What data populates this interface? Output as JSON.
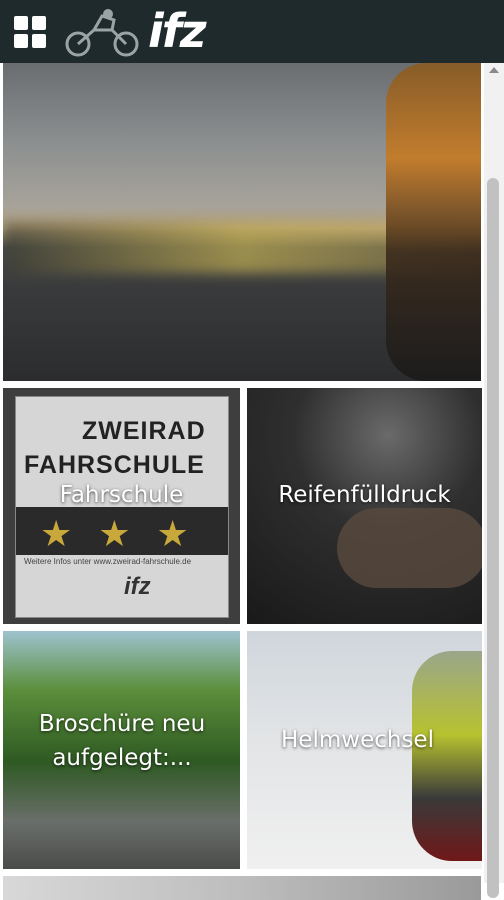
{
  "header": {
    "menu_icon": "grid-icon",
    "logo_text": "ifz",
    "logo_icon": "motorcycle-icon"
  },
  "tiles": [
    {
      "label": "Fahrschule",
      "card": {
        "line1": "ZWEIRAD",
        "line2": "FAHRSCHULE",
        "stars": "★★★",
        "url": "Weitere Infos unter www.zweirad-fahrschule.de",
        "minilogo": "ifz"
      }
    },
    {
      "label": "Reifenfülldruck"
    },
    {
      "label": "Broschüre neu aufgelegt:..."
    },
    {
      "label": "Helmwechsel"
    }
  ]
}
